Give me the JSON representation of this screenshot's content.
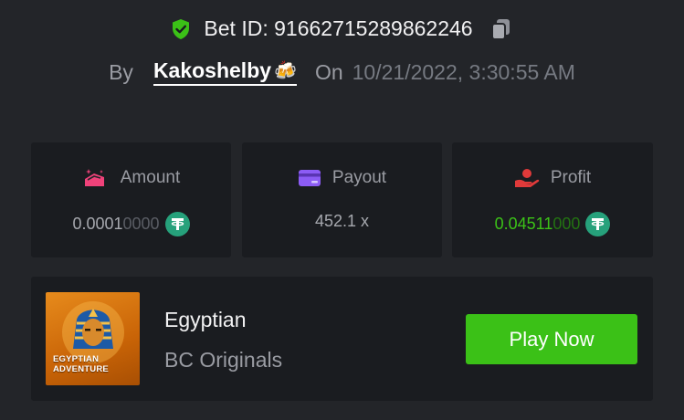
{
  "header": {
    "bet_id_label": "Bet ID: 91662715289862246",
    "by_label": "By",
    "username": "Kakoshelby",
    "user_emoji": "🍻",
    "on_label": "On",
    "datetime": "10/21/2022, 3:30:55 AM"
  },
  "stats": {
    "amount": {
      "label": "Amount",
      "value_main": "0.0001",
      "value_trailing": "0000",
      "currency_icon": "tether-icon"
    },
    "payout": {
      "label": "Payout",
      "value": "452.1 x"
    },
    "profit": {
      "label": "Profit",
      "value_main": "0.04511",
      "value_trailing": "000",
      "currency_icon": "tether-icon"
    }
  },
  "game": {
    "thumbnail_text_line1": "EGYPTIAN",
    "thumbnail_text_line2": "ADVENTURE",
    "name": "Egyptian",
    "provider": "BC Originals",
    "play_label": "Play Now"
  },
  "colors": {
    "background": "#232529",
    "card": "#1a1c20",
    "accent_green": "#3bc117",
    "tether": "#26a17b",
    "amount_icon": "#f0427a",
    "payout_icon": "#8c5cf5",
    "profit_icon": "#e03a3a",
    "shield": "#3bc117"
  }
}
